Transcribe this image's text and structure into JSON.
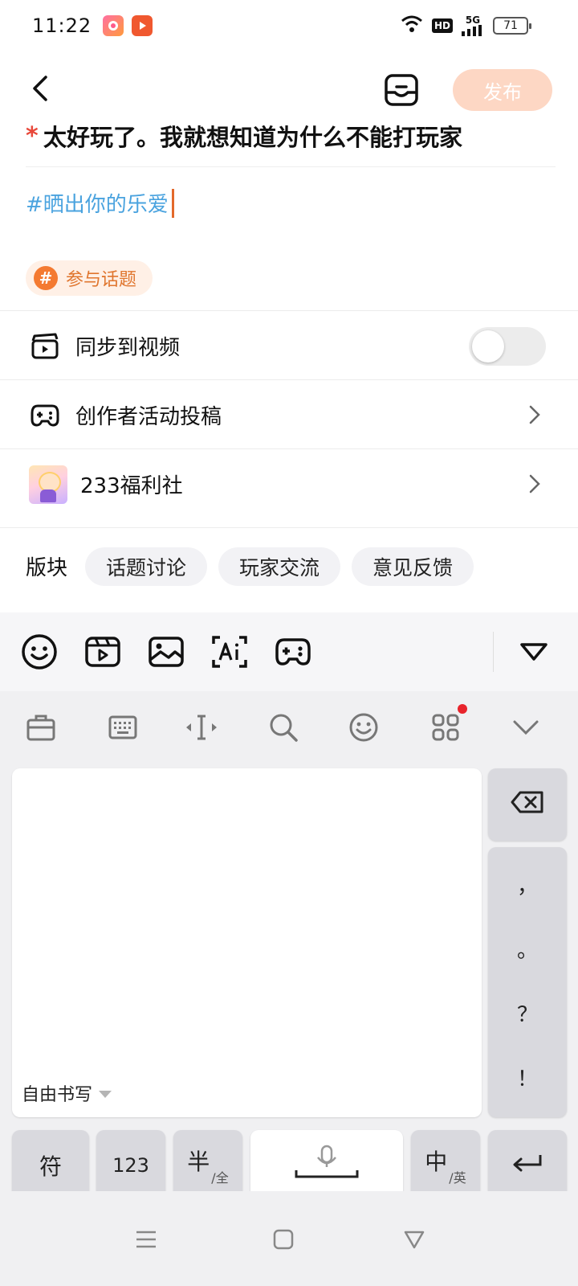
{
  "status_bar": {
    "time": "11:22",
    "hd": "HD",
    "network": "5G",
    "battery": "71"
  },
  "header": {
    "publish_label": "发布"
  },
  "post": {
    "title": "太好玩了。我就想知道为什么不能打玩家",
    "body": "#晒出你的乐爱",
    "topic_button": "参与话题"
  },
  "options": {
    "sync_video": "同步到视频",
    "sync_video_on": false,
    "creator_activity": "创作者活动投稿",
    "community": "233福利社"
  },
  "section": {
    "label": "版块",
    "pills": [
      "话题讨论",
      "玩家交流",
      "意见反馈"
    ]
  },
  "keyboard": {
    "handwriting_mode": "自由书写",
    "punctuation": [
      "，",
      "。",
      "？",
      "！"
    ],
    "symbols_key": "符",
    "numbers_key": "123",
    "halfwidth_key": "半",
    "halfwidth_sub": "全",
    "lang_key": "中",
    "lang_sub": "英"
  },
  "colors": {
    "accent": "#f47a31",
    "publish_disabled": "#fdd7c4",
    "hashtag": "#4aa3df",
    "required": "#e8483a"
  }
}
